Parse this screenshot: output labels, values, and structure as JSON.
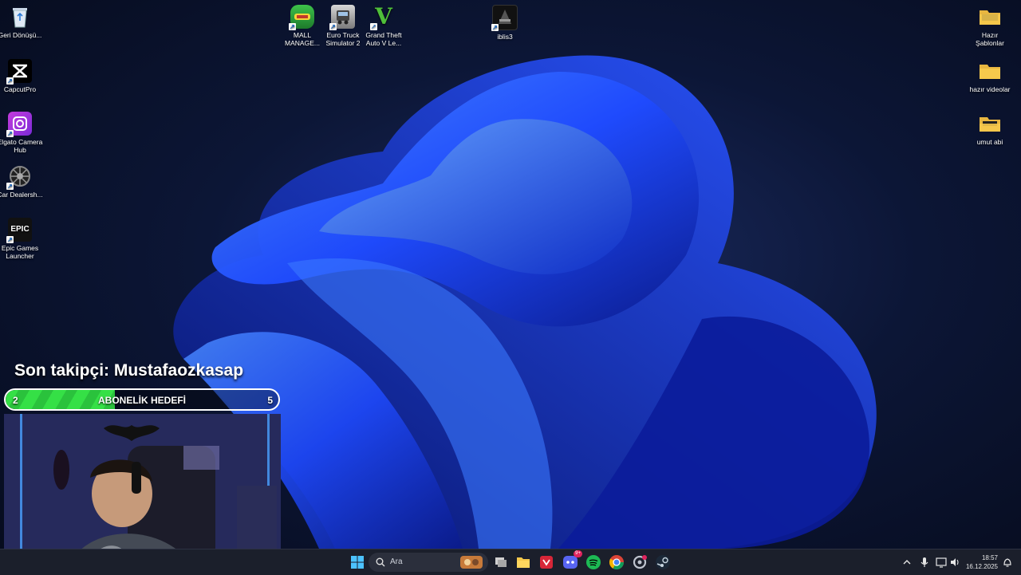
{
  "desktop": {
    "left_icons": [
      {
        "label": "Geri Dönüşü..."
      },
      {
        "label": "CapcutPro"
      },
      {
        "label": "Elgato Camera Hub"
      },
      {
        "label": "Car Dealersh..."
      },
      {
        "label": "Epic Games Launcher"
      }
    ],
    "top_icons": [
      {
        "label": "MALL MANAGE..."
      },
      {
        "label": "Euro Truck Simulator 2"
      },
      {
        "label": "Grand Theft Auto V Le..."
      },
      {
        "label": "iblis3"
      }
    ],
    "right_icons": [
      {
        "label": "Hazır Şablonlar"
      },
      {
        "label": "hazır videolar"
      },
      {
        "label": "umut abi"
      }
    ],
    "icon_glyphs": {
      "epic": "EPIC",
      "gta": "V"
    }
  },
  "stream_overlay": {
    "last_follower": "Son takipçi: Mustafaozkasap",
    "goal": {
      "label": "ABONELİK HEDEFİ",
      "current": "2",
      "target": "5",
      "progress_fraction": 0.4
    }
  },
  "taskbar": {
    "search_placeholder": "Ara",
    "discord_badge": "9+",
    "time": "18:57",
    "date": "16.12.2025"
  },
  "colors": {
    "accent": "#2f5bff",
    "goal_green": "#35e046",
    "taskbar_bg": "#1b1f2b"
  }
}
